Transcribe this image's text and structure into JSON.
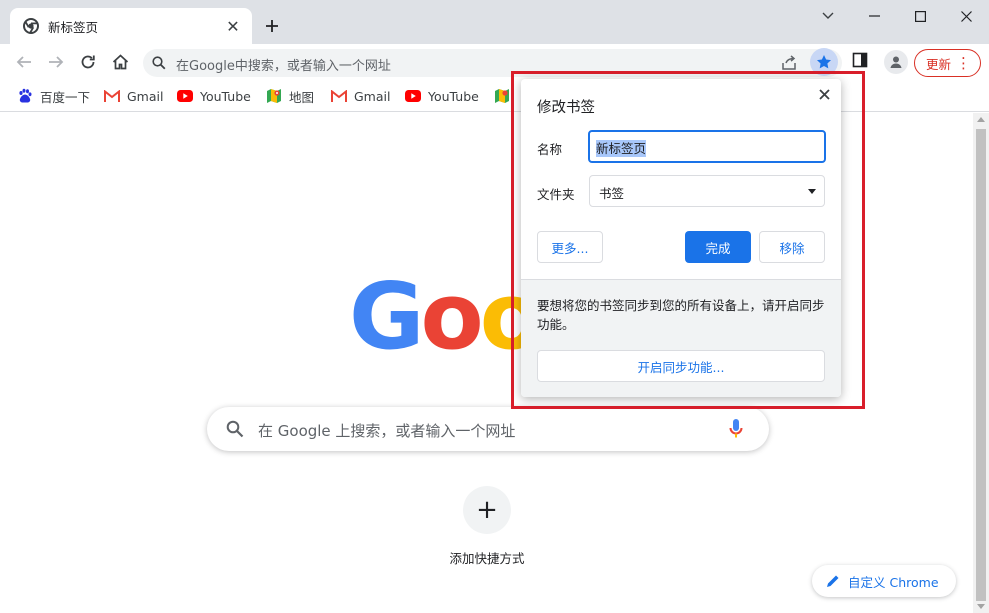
{
  "tab": {
    "title": "新标签页",
    "close": "✕"
  },
  "omnibox": {
    "placeholder": "在Google中搜索，或者输入一个网址"
  },
  "toolbar": {
    "update_label": "更新",
    "update_menu": "⋮"
  },
  "bookmarks": [
    {
      "label": "百度一下",
      "icon": "baidu-icon"
    },
    {
      "label": "Gmail",
      "icon": "gmail-icon"
    },
    {
      "label": "YouTube",
      "icon": "youtube-icon"
    },
    {
      "label": "地图",
      "icon": "maps-icon"
    },
    {
      "label": "Gmail",
      "icon": "gmail-icon"
    },
    {
      "label": "YouTube",
      "icon": "youtube-icon"
    }
  ],
  "bubble": {
    "title": "修改书签",
    "name_label": "名称",
    "name_value": "新标签页",
    "folder_label": "文件夹",
    "folder_value": "书签",
    "more_label": "更多...",
    "done_label": "完成",
    "remove_label": "移除",
    "sync_text": "要想将您的书签同步到您的所有设备上，请开启同步功能。",
    "sync_button": "开启同步功能..."
  },
  "ntp": {
    "logo_letters": [
      "G",
      "o",
      "o"
    ],
    "search_placeholder": "在 Google 上搜索，或者输入一个网址",
    "add_shortcut_symbol": "+",
    "add_shortcut_label": "添加快捷方式",
    "customize_label": "自定义 Chrome"
  },
  "colors": {
    "accent": "#1a73e8",
    "highlight": "#d91e2a",
    "google_blue": "#4285f4",
    "google_red": "#ea4335",
    "google_yellow": "#fbbc05"
  }
}
